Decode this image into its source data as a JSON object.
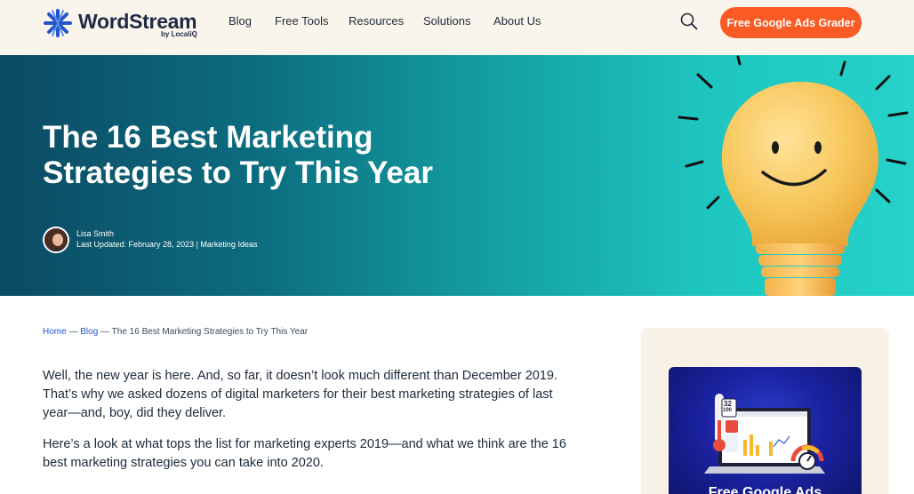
{
  "header": {
    "logo_text": "WordStream",
    "logo_sub": "by LocaliQ",
    "nav": [
      "Blog",
      "Free Tools",
      "Resources",
      "Solutions",
      "About Us"
    ],
    "cta_label": "Free Google Ads Grader",
    "icons": {
      "search": "search-icon",
      "logo": "wordstream-logo-icon"
    }
  },
  "hero": {
    "title": "The 16 Best Marketing Strategies to Try This Year",
    "author": "Lisa Smith",
    "meta": "Last Updated: February 28, 2023 | Marketing Ideas"
  },
  "breadcrumb": {
    "home": "Home",
    "sep1": " — ",
    "blog": "Blog",
    "sep2": " — ",
    "current": "The 16 Best Marketing Strategies to Try This Year"
  },
  "article": {
    "p1": "Well, the new year is here. And, so far, it doesn’t look much different than December 2019. That’s why we asked dozens of digital marketers for their best marketing strategies of last year—and, boy, did they deliver.",
    "p2": "Here’s a look at what tops the list for marketing experts 2019—and what we think are the 16 best marketing strategies you can take into 2020."
  },
  "sidebar": {
    "promo_score": "32",
    "promo_score_total": "100",
    "promo_title": "Free Google Ads"
  },
  "colors": {
    "accent": "#fa5a23",
    "link": "#2456c9",
    "header_bg": "#faf5ec",
    "sidebar_bg": "#f7f1e6",
    "hero_start": "#0b4a63",
    "hero_end": "#26d2c9"
  }
}
